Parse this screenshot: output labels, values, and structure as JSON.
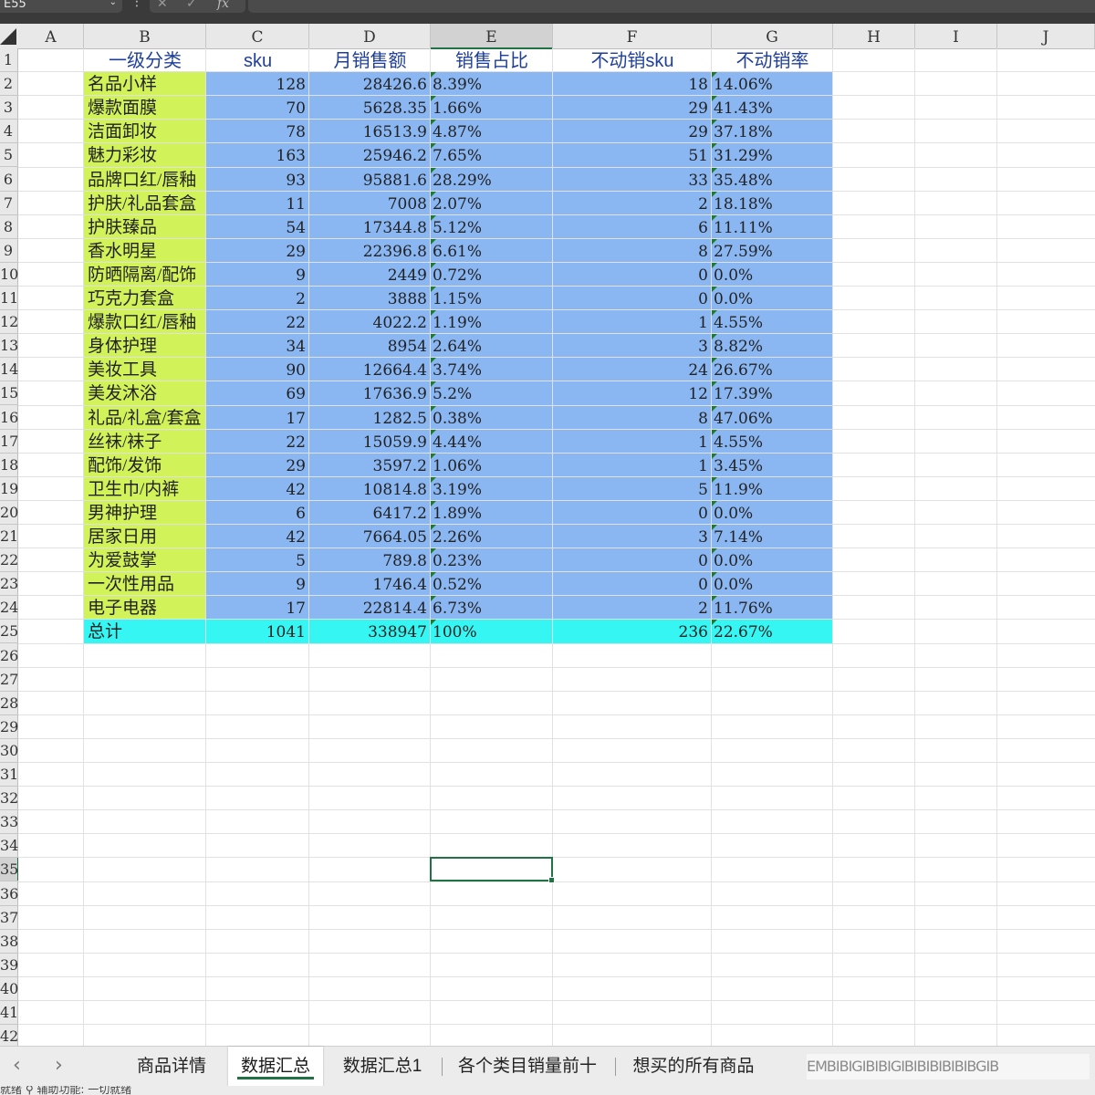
{
  "formula_bar": {
    "name_box": "E55",
    "fx_symbol": "fx",
    "cancel_glyph": "✕",
    "enter_glyph": "✓",
    "formula": ""
  },
  "columns": [
    "A",
    "B",
    "C",
    "D",
    "E",
    "F",
    "G",
    "H",
    "I",
    "J"
  ],
  "rows": [
    "1",
    "2",
    "3",
    "4",
    "5",
    "6",
    "7",
    "8",
    "9",
    "10",
    "11",
    "12",
    "13",
    "14",
    "15",
    "16",
    "17",
    "18",
    "19",
    "20",
    "21",
    "22",
    "23",
    "24",
    "25",
    "26",
    "27",
    "28",
    "29",
    "30",
    "31",
    "32",
    "33",
    "34",
    "35",
    "36",
    "37",
    "38",
    "39",
    "40",
    "41",
    "42"
  ],
  "table": {
    "headers": [
      "一级分类",
      "sku",
      "月销售额",
      "销售占比",
      "不动销sku",
      "不动销率"
    ],
    "rows": [
      [
        "名品小样",
        "128",
        "28426.6",
        "8.39%",
        "18",
        "14.06%"
      ],
      [
        "爆款面膜",
        "70",
        "5628.35",
        "1.66%",
        "29",
        "41.43%"
      ],
      [
        "洁面卸妆",
        "78",
        "16513.9",
        "4.87%",
        "29",
        "37.18%"
      ],
      [
        "魅力彩妆",
        "163",
        "25946.2",
        "7.65%",
        "51",
        "31.29%"
      ],
      [
        "品牌口红/唇釉",
        "93",
        "95881.6",
        "28.29%",
        "33",
        "35.48%"
      ],
      [
        "护肤/礼品套盒",
        "11",
        "7008",
        "2.07%",
        "2",
        "18.18%"
      ],
      [
        "护肤臻品",
        "54",
        "17344.8",
        "5.12%",
        "6",
        "11.11%"
      ],
      [
        "香水明星",
        "29",
        "22396.8",
        "6.61%",
        "8",
        "27.59%"
      ],
      [
        "防晒隔离/配饰",
        "9",
        "2449",
        "0.72%",
        "0",
        "0.0%"
      ],
      [
        "巧克力套盒",
        "2",
        "3888",
        "1.15%",
        "0",
        "0.0%"
      ],
      [
        "爆款口红/唇釉",
        "22",
        "4022.2",
        "1.19%",
        "1",
        "4.55%"
      ],
      [
        "身体护理",
        "34",
        "8954",
        "2.64%",
        "3",
        "8.82%"
      ],
      [
        "美妆工具",
        "90",
        "12664.4",
        "3.74%",
        "24",
        "26.67%"
      ],
      [
        "美发沐浴",
        "69",
        "17636.9",
        "5.2%",
        "12",
        "17.39%"
      ],
      [
        "礼品/礼盒/套盒",
        "17",
        "1282.5",
        "0.38%",
        "8",
        "47.06%"
      ],
      [
        "丝袜/袜子",
        "22",
        "15059.9",
        "4.44%",
        "1",
        "4.55%"
      ],
      [
        "配饰/发饰",
        "29",
        "3597.2",
        "1.06%",
        "1",
        "3.45%"
      ],
      [
        "卫生巾/内裤",
        "42",
        "10814.8",
        "3.19%",
        "5",
        "11.9%"
      ],
      [
        "男神护理",
        "6",
        "6417.2",
        "1.89%",
        "0",
        "0.0%"
      ],
      [
        "居家日用",
        "42",
        "7664.05",
        "2.26%",
        "3",
        "7.14%"
      ],
      [
        "为爱鼓掌",
        "5",
        "789.8",
        "0.23%",
        "0",
        "0.0%"
      ],
      [
        "一次性用品",
        "9",
        "1746.4",
        "0.52%",
        "0",
        "0.0%"
      ],
      [
        "电子电器",
        "17",
        "22814.4",
        "6.73%",
        "2",
        "11.76%"
      ]
    ],
    "total": [
      "总计",
      "1041",
      "338947",
      "100%",
      "236",
      "22.67%"
    ]
  },
  "colors": {
    "category_fill": "#d2f25a",
    "data_fill": "#8ab6f2",
    "total_fill": "#35f6f2",
    "header_text": "#1f3f99",
    "selection": "#217346"
  },
  "tabs": {
    "prev_glyph": "‹",
    "next_glyph": "›",
    "items": [
      "商品详情",
      "数据汇总",
      "数据汇总1",
      "各个类目销量前十",
      "想买的所有商品"
    ],
    "active_index": 1,
    "overlay_text": "EMBIBIGIBIBIGIBIBIBIBIBIBGIB"
  },
  "status_bar": {
    "text": "就绪  ⚲ 辅助功能: 一切就绪"
  }
}
